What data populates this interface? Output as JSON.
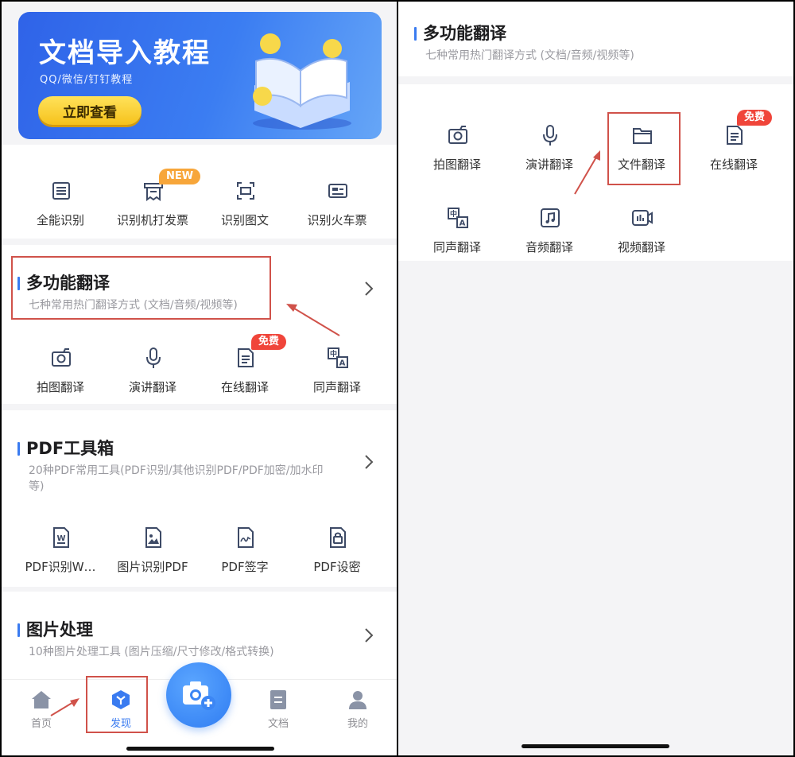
{
  "banner": {
    "title": "文档导入教程",
    "subtitle": "QQ/微信/钉钉教程",
    "button": "立即查看"
  },
  "top_tools": [
    {
      "label": "全能识别",
      "icon": "scan-icon"
    },
    {
      "label": "识别机打发票",
      "icon": "invoice-icon",
      "badge": "NEW"
    },
    {
      "label": "识别图文",
      "icon": "scan-text-icon"
    },
    {
      "label": "识别火车票",
      "icon": "train-ticket-icon"
    }
  ],
  "translation": {
    "title": "多功能翻译",
    "desc": "七种常用热门翻译方式 (文档/音频/视频等)",
    "tools": [
      {
        "label": "拍图翻译",
        "icon": "camera-icon"
      },
      {
        "label": "演讲翻译",
        "icon": "microphone-icon"
      },
      {
        "label": "在线翻译",
        "icon": "document-icon",
        "badge": "免费"
      },
      {
        "label": "同声翻译",
        "icon": "bilingual-icon"
      }
    ]
  },
  "pdf": {
    "title": "PDF工具箱",
    "desc_line1": "20种PDF常用工具(PDF识别/其他识别PDF/PDF加密/加水印",
    "desc_line2": "等)",
    "tools": [
      {
        "label": "PDF识别W…",
        "icon": "pdf-word-icon"
      },
      {
        "label": "图片识别PDF",
        "icon": "image-pdf-icon"
      },
      {
        "label": "PDF签字",
        "icon": "signature-icon"
      },
      {
        "label": "PDF设密",
        "icon": "lock-icon"
      }
    ]
  },
  "image_processing": {
    "title": "图片处理",
    "desc": "10种图片处理工具 (图片压缩/尺寸修改/格式转换)"
  },
  "nav": [
    {
      "label": "首页",
      "icon": "home-icon"
    },
    {
      "label": "发现",
      "icon": "discover-icon"
    },
    {
      "label": "文档",
      "icon": "docs-icon"
    },
    {
      "label": "我的",
      "icon": "profile-icon"
    }
  ],
  "right": {
    "title": "多功能翻译",
    "desc": "七种常用热门翻译方式 (文档/音频/视频等)",
    "tools": [
      {
        "label": "拍图翻译",
        "icon": "camera-icon"
      },
      {
        "label": "演讲翻译",
        "icon": "microphone-icon"
      },
      {
        "label": "文件翻译",
        "icon": "folder-icon"
      },
      {
        "label": "在线翻译",
        "icon": "document-icon",
        "badge": "免费"
      },
      {
        "label": "同声翻译",
        "icon": "bilingual-icon"
      },
      {
        "label": "音频翻译",
        "icon": "audio-icon"
      },
      {
        "label": "视频翻译",
        "icon": "video-icon"
      }
    ]
  },
  "colors": {
    "accent": "#3a7bf0",
    "highlight": "#d0524a",
    "badge_new": "#f7a63a",
    "badge_free": "#f0453a"
  }
}
